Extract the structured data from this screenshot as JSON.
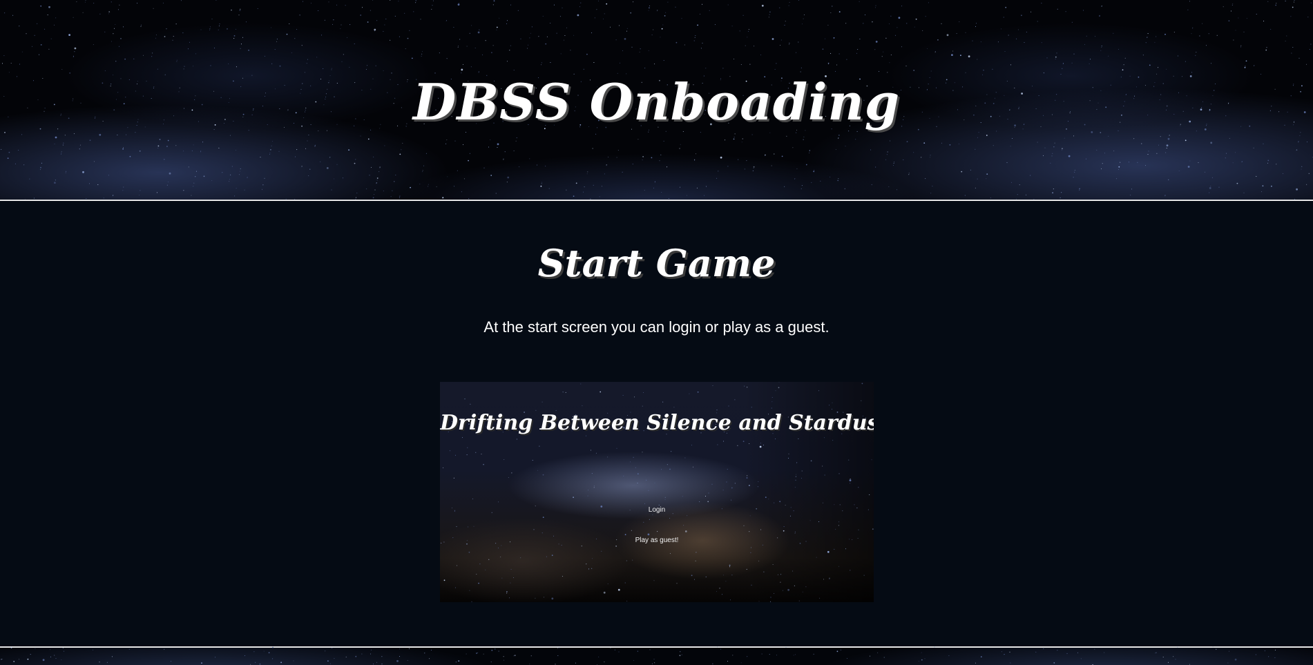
{
  "header": {
    "title": "DBSS Onboading"
  },
  "main": {
    "section_title": "Start Game",
    "section_text": "At the start screen you can login or play as a guest.",
    "screenshot": {
      "game_title": "Drifting Between Silence and Stardust:",
      "login_label": "Login",
      "guest_label": "Play as guest!"
    }
  },
  "colors": {
    "page_background": "#050b14",
    "divider": "#e8e8e8",
    "text": "#ffffff"
  }
}
